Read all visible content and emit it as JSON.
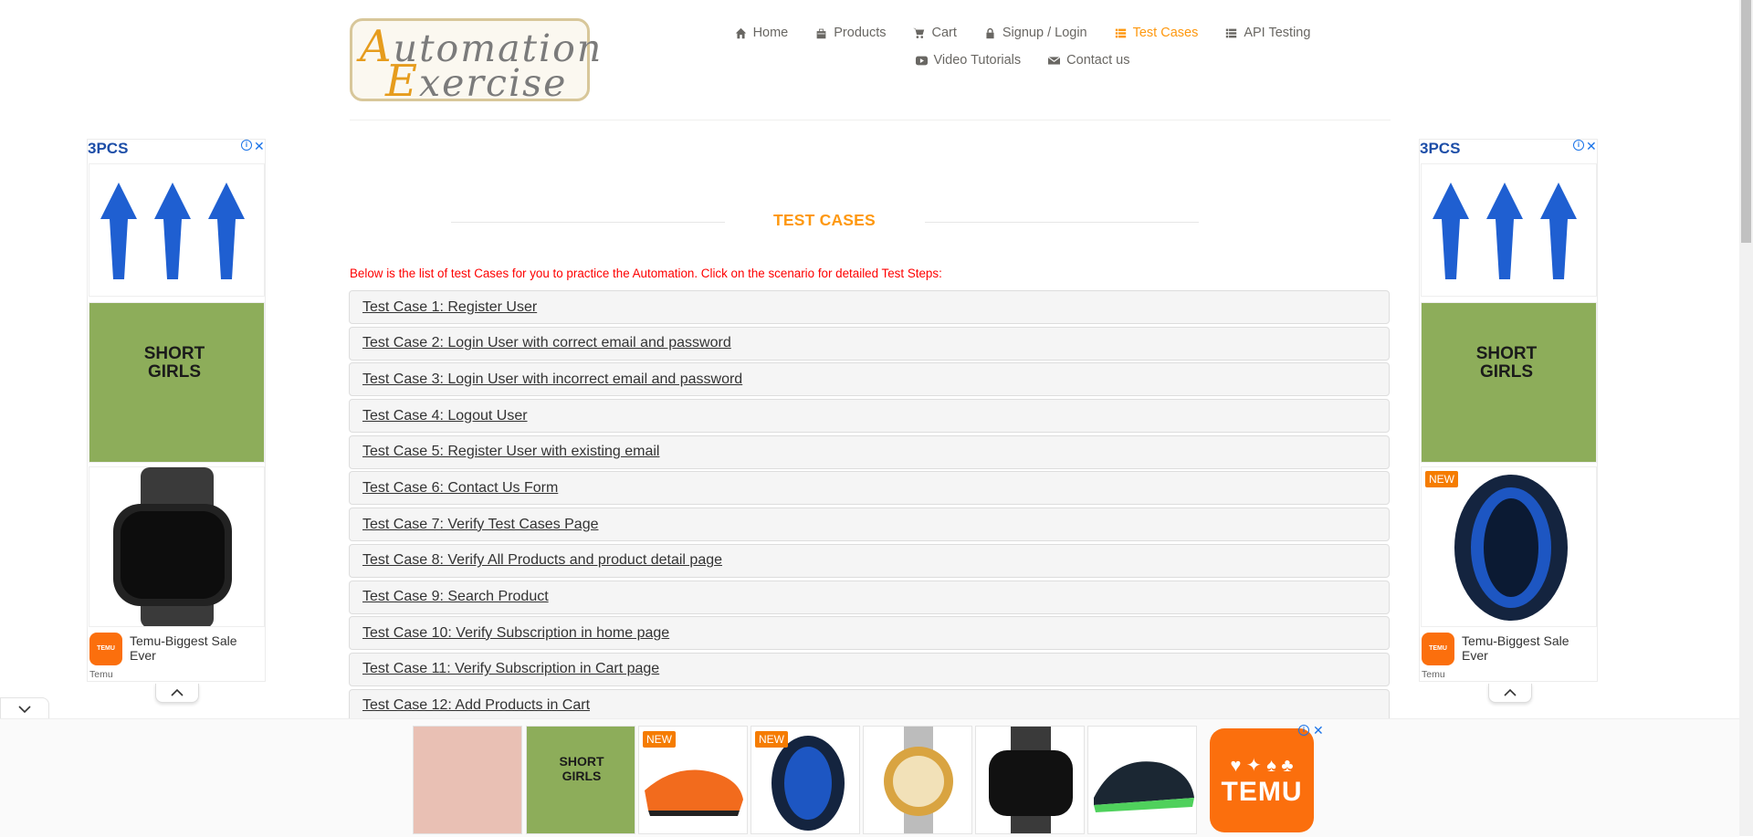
{
  "logo": {
    "line1": "Automation",
    "line2": "Exercise"
  },
  "nav": {
    "row1": [
      {
        "label": "Home",
        "icon": "home-icon",
        "active": false
      },
      {
        "label": "Products",
        "icon": "products-icon",
        "active": false
      },
      {
        "label": "Cart",
        "icon": "cart-icon",
        "active": false
      },
      {
        "label": "Signup / Login",
        "icon": "lock-icon",
        "active": false
      },
      {
        "label": "Test Cases",
        "icon": "list-icon",
        "active": true
      },
      {
        "label": "API Testing",
        "icon": "list-icon",
        "active": false
      }
    ],
    "row2": [
      {
        "label": "Video Tutorials",
        "icon": "youtube-icon",
        "active": false
      },
      {
        "label": "Contact us",
        "icon": "envelope-icon",
        "active": false
      }
    ]
  },
  "page": {
    "title": "TEST CASES",
    "intro": "Below is the list of test Cases for you to practice the Automation. Click on the scenario for detailed Test Steps:"
  },
  "test_cases": [
    "Test Case 1: Register User",
    "Test Case 2: Login User with correct email and password",
    "Test Case 3: Login User with incorrect email and password",
    "Test Case 4: Logout User",
    "Test Case 5: Register User with existing email",
    "Test Case 6: Contact Us Form",
    "Test Case 7: Verify Test Cases Page",
    "Test Case 8: Verify All Products and product detail page",
    "Test Case 9: Search Product",
    "Test Case 10: Verify Subscription in home page",
    "Test Case 11: Verify Subscription in Cart page",
    "Test Case 12: Add Products in Cart"
  ],
  "ads": {
    "left": {
      "headline": "3PCS",
      "title": "Temu-Biggest Sale Ever",
      "brand": "Temu",
      "logo_text": "TEMU"
    },
    "right": {
      "headline": "3PCS",
      "badge": "NEW",
      "title": "Temu-Biggest Sale Ever",
      "brand": "Temu",
      "logo_text": "TEMU"
    },
    "bottom": {
      "badges": [
        "NEW",
        "NEW"
      ],
      "brand_logo": "TEMU",
      "shirt_text": "SHORT GIRLS"
    },
    "shirt_text": "SHORT GIRLS",
    "colors": {
      "temu_orange": "#fb6f0d",
      "accent": "#fe980f",
      "ad_blue": "#1d4ea8"
    }
  }
}
